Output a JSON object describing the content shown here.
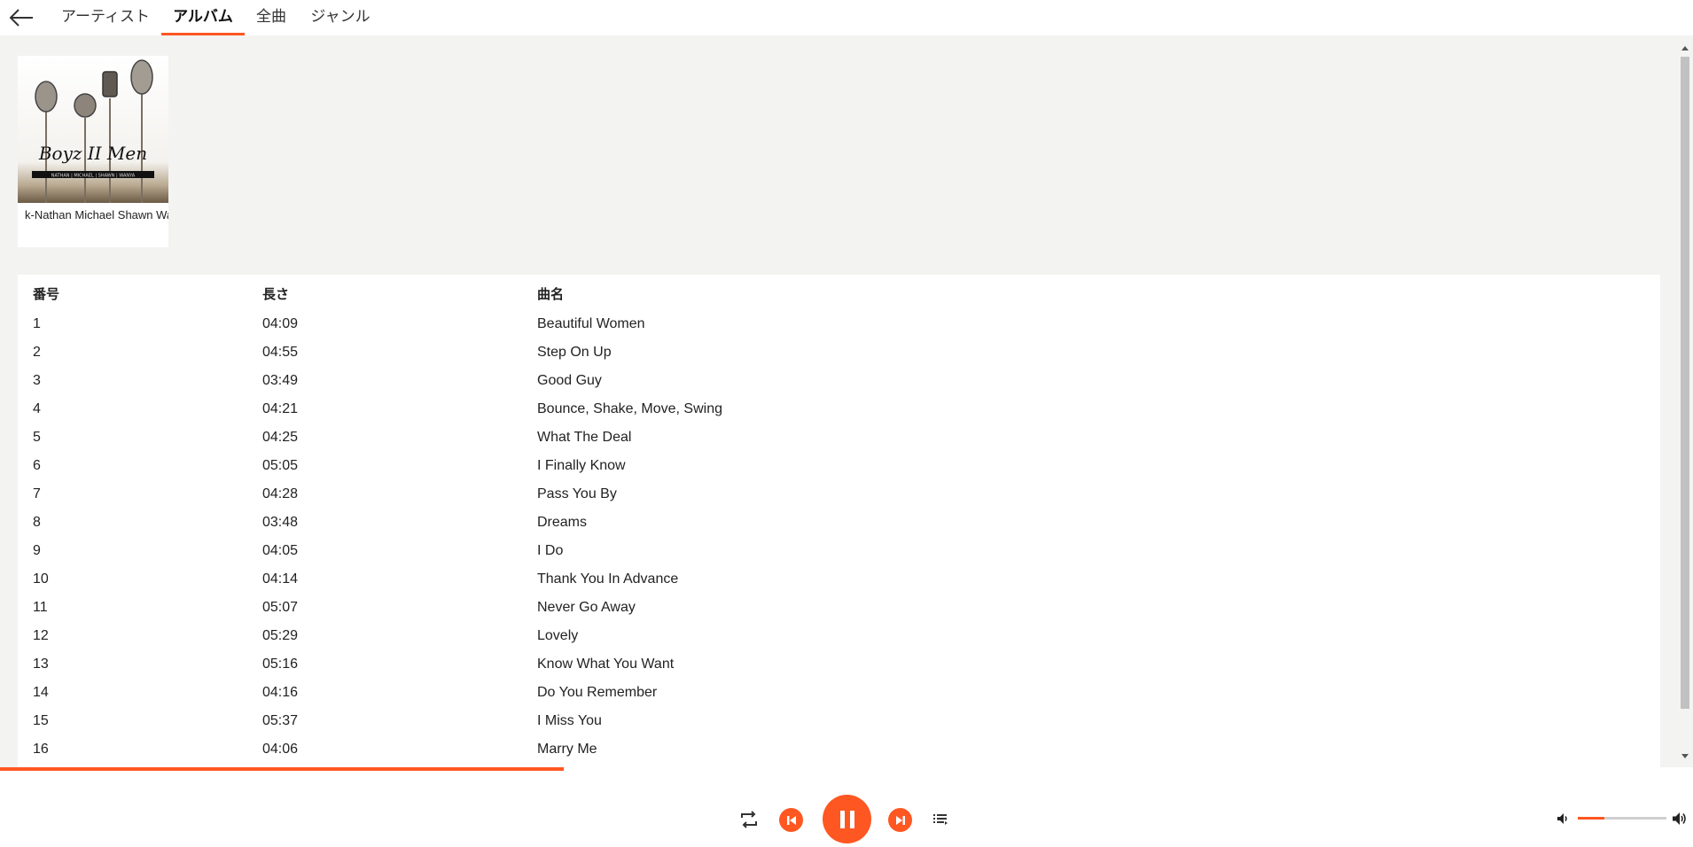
{
  "nav": {
    "back_icon": "arrow-left-icon",
    "tabs": [
      {
        "label": "アーティスト",
        "active": false
      },
      {
        "label": "アルバム",
        "active": true
      },
      {
        "label": "全曲",
        "active": false
      },
      {
        "label": "ジャンル",
        "active": false
      }
    ]
  },
  "album": {
    "label": "k-Nathan Michael Shawn Wanya",
    "art_text": "Boyz II Men",
    "art_subtitle": "NATHAN | MICHAEL | SHAWN | WANYA"
  },
  "tracks": {
    "headers": {
      "number": "番号",
      "length": "長さ",
      "title": "曲名"
    },
    "rows": [
      {
        "number": "1",
        "length": "04:09",
        "title": "Beautiful Women"
      },
      {
        "number": "2",
        "length": "04:55",
        "title": "Step On Up"
      },
      {
        "number": "3",
        "length": "03:49",
        "title": "Good Guy"
      },
      {
        "number": "4",
        "length": "04:21",
        "title": "Bounce, Shake, Move, Swing"
      },
      {
        "number": "5",
        "length": "04:25",
        "title": "What The Deal"
      },
      {
        "number": "6",
        "length": "05:05",
        "title": "I Finally Know"
      },
      {
        "number": "7",
        "length": "04:28",
        "title": "Pass You By"
      },
      {
        "number": "8",
        "length": "03:48",
        "title": "Dreams"
      },
      {
        "number": "9",
        "length": "04:05",
        "title": "I Do"
      },
      {
        "number": "10",
        "length": "04:14",
        "title": "Thank You In Advance"
      },
      {
        "number": "11",
        "length": "05:07",
        "title": "Never Go Away"
      },
      {
        "number": "12",
        "length": "05:29",
        "title": "Lovely"
      },
      {
        "number": "13",
        "length": "05:16",
        "title": "Know What You Want"
      },
      {
        "number": "14",
        "length": "04:16",
        "title": "Do You Remember"
      },
      {
        "number": "15",
        "length": "05:37",
        "title": "I Miss You"
      },
      {
        "number": "16",
        "length": "04:06",
        "title": "Marry Me"
      }
    ]
  },
  "player": {
    "progress": 0.333,
    "volume": 0.3,
    "accent_color": "#ff5722",
    "icons": {
      "repeat": "repeat-icon",
      "previous": "skip-previous-icon",
      "play_pause": "pause-icon",
      "next": "skip-next-icon",
      "queue": "queue-list-icon",
      "volume_low": "volume-low-icon",
      "volume_high": "volume-high-icon"
    }
  }
}
